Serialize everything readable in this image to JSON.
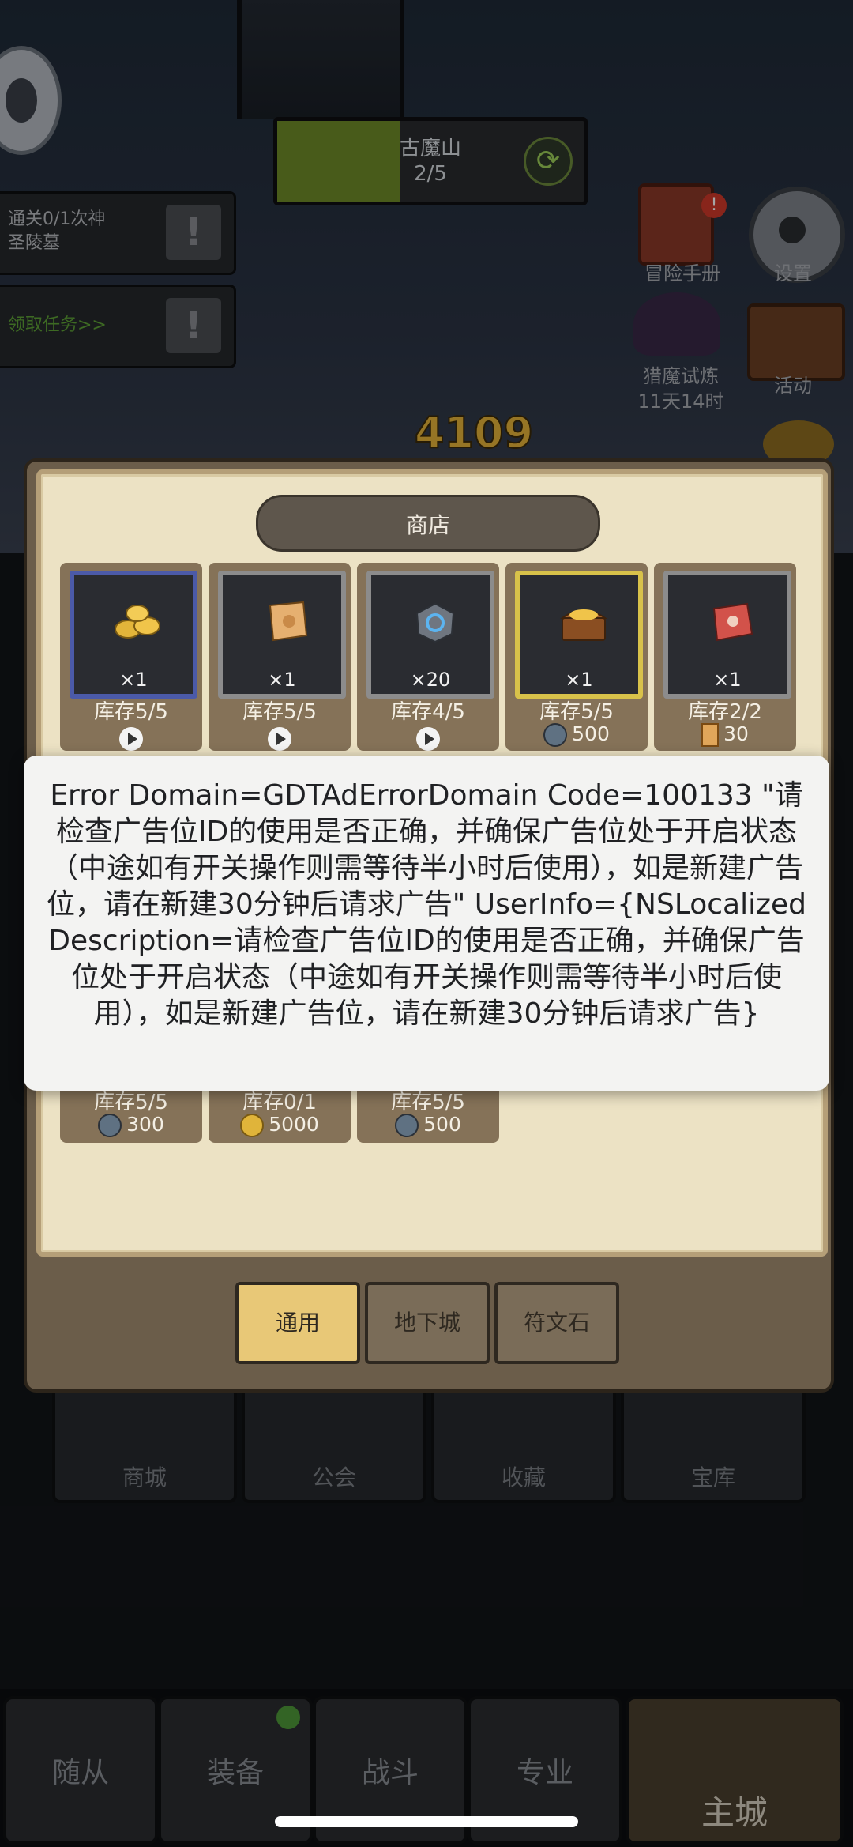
{
  "hud": {
    "stage_name": "古魔山",
    "stage_progress": "2/5",
    "stage_fill_fraction": 0.4,
    "score": "4109",
    "quests": [
      {
        "line1": "通关0/1次神",
        "line2": "圣陵墓"
      },
      {
        "line1": "领取任务>>",
        "line2": ""
      }
    ],
    "side_menu": {
      "adventure_book": "冒险手册",
      "settings": "设置",
      "demon_trial": "猎魔试炼",
      "demon_trial_timer": "11天14时",
      "events": "活动"
    }
  },
  "shop": {
    "title": "商店",
    "items": [
      {
        "qty": "×1",
        "stock": "库存5/5",
        "price_type": "ad",
        "price": "",
        "icon": "gold-coins-icon",
        "frame": "blue"
      },
      {
        "qty": "×1",
        "stock": "库存5/5",
        "price_type": "ad",
        "price": "",
        "icon": "scroll-icon",
        "frame": "gray"
      },
      {
        "qty": "×20",
        "stock": "库存4/5",
        "price_type": "ad",
        "price": "",
        "icon": "rune-stone-icon",
        "frame": "gray"
      },
      {
        "qty": "×1",
        "stock": "库存5/5",
        "price_type": "gem",
        "price": "500",
        "icon": "treasure-chest-icon",
        "frame": "gold"
      },
      {
        "qty": "×1",
        "stock": "库存2/2",
        "price_type": "scroll",
        "price": "30",
        "icon": "red-scroll-icon",
        "frame": "gray"
      }
    ],
    "items_row2": [
      {
        "stock": "库存5/5",
        "price_type": "gem",
        "price": "300"
      },
      {
        "stock": "库存0/1",
        "price_type": "coin",
        "price": "5000"
      },
      {
        "stock": "库存5/5",
        "price_type": "gem",
        "price": "500"
      }
    ],
    "tabs": [
      {
        "label": "通用",
        "active": true
      },
      {
        "label": "地下城",
        "active": false
      },
      {
        "label": "符文石",
        "active": false
      }
    ]
  },
  "error_toast": {
    "message": "Error Domain=GDTAdErrorDomain Code=100133 \"请检查广告位ID的使用是否正确，并确保广告位处于开启状态（中途如有开关操作则需等待半小时后使用），如是新建广告位，请在新建30分钟后请求广告\" UserInfo={NSLocalizedDescription=请检查广告位ID的使用是否正确，并确保广告位处于开启状态（中途如有开关操作则需等待半小时后使用），如是新建广告位，请在新建30分钟后请求广告}"
  },
  "mid_buttons": [
    "商城",
    "公会",
    "收藏",
    "宝库"
  ],
  "bottom_nav": [
    "随从",
    "装备",
    "战斗",
    "专业",
    "主城"
  ]
}
